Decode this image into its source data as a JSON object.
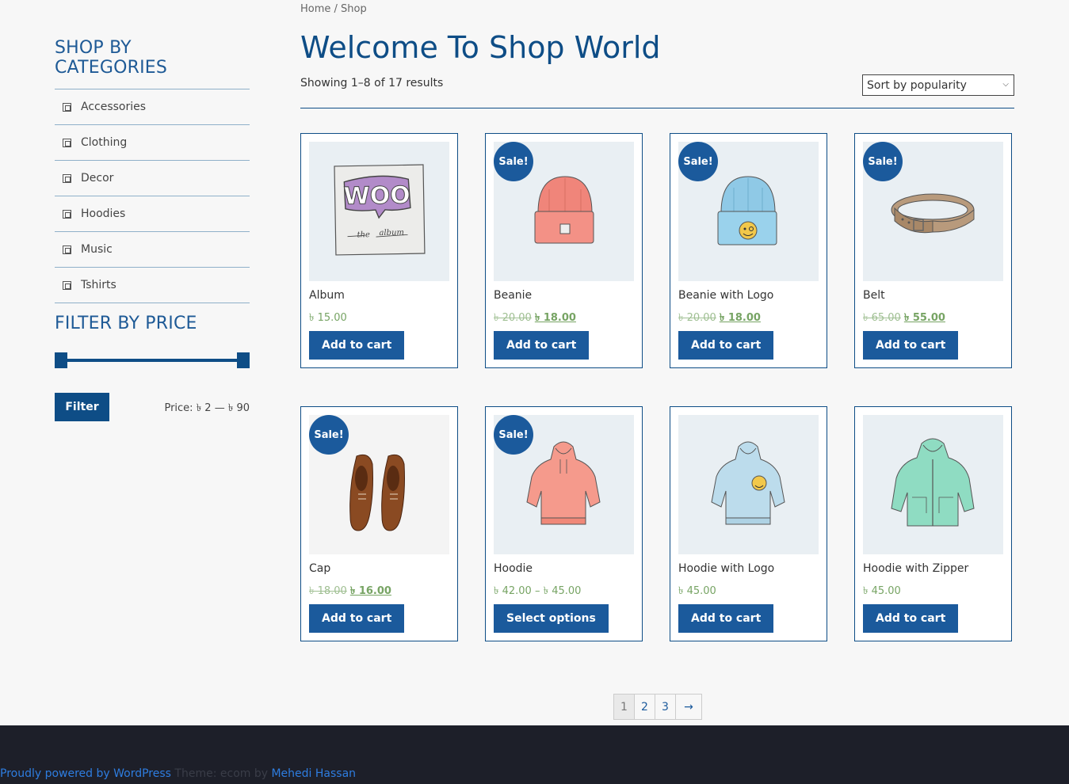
{
  "sidebar": {
    "categories_title": "SHOP BY CATEGORIES",
    "categories": [
      "Accessories",
      "Clothing",
      "Decor",
      "Hoodies",
      "Music",
      "Tshirts"
    ],
    "price_title": "FILTER BY PRICE",
    "filter_label": "Filter",
    "price_range": "Price: ৳ 2 — ৳ 90"
  },
  "main": {
    "breadcrumb": "Home / Shop",
    "title": "Welcome To Shop World",
    "result_count": "Showing 1–8 of 17 results",
    "sort_selected": "Sort by popularity"
  },
  "products": [
    {
      "name": "Album",
      "price": "৳ 15.00",
      "old_price": "",
      "sale_price": "",
      "sale": false,
      "button": "Add to cart"
    },
    {
      "name": "Beanie",
      "price": "",
      "old_price": "৳ 20.00",
      "sale_price": "৳ 18.00",
      "sale": true,
      "button": "Add to cart"
    },
    {
      "name": "Beanie with Logo",
      "price": "",
      "old_price": "৳ 20.00",
      "sale_price": "৳ 18.00",
      "sale": true,
      "button": "Add to cart"
    },
    {
      "name": "Belt",
      "price": "",
      "old_price": "৳ 65.00",
      "sale_price": "৳ 55.00",
      "sale": true,
      "button": "Add to cart"
    },
    {
      "name": "Cap",
      "price": "",
      "old_price": "৳ 18.00",
      "sale_price": "৳ 16.00",
      "sale": true,
      "button": "Add to cart"
    },
    {
      "name": "Hoodie",
      "price": "৳ 42.00 – ৳ 45.00",
      "old_price": "",
      "sale_price": "",
      "sale": true,
      "button": "Select options"
    },
    {
      "name": "Hoodie with Logo",
      "price": "৳ 45.00",
      "old_price": "",
      "sale_price": "",
      "sale": false,
      "button": "Add to cart"
    },
    {
      "name": "Hoodie with Zipper",
      "price": "৳ 45.00",
      "old_price": "",
      "sale_price": "",
      "sale": false,
      "button": "Add to cart"
    }
  ],
  "sale_label": "Sale!",
  "pagination": [
    "1",
    "2",
    "3",
    "→"
  ],
  "footer": {
    "powered": "Proudly powered by WordPress",
    "theme": "Theme: ecom by",
    "author": "Mehedi Hassan"
  }
}
